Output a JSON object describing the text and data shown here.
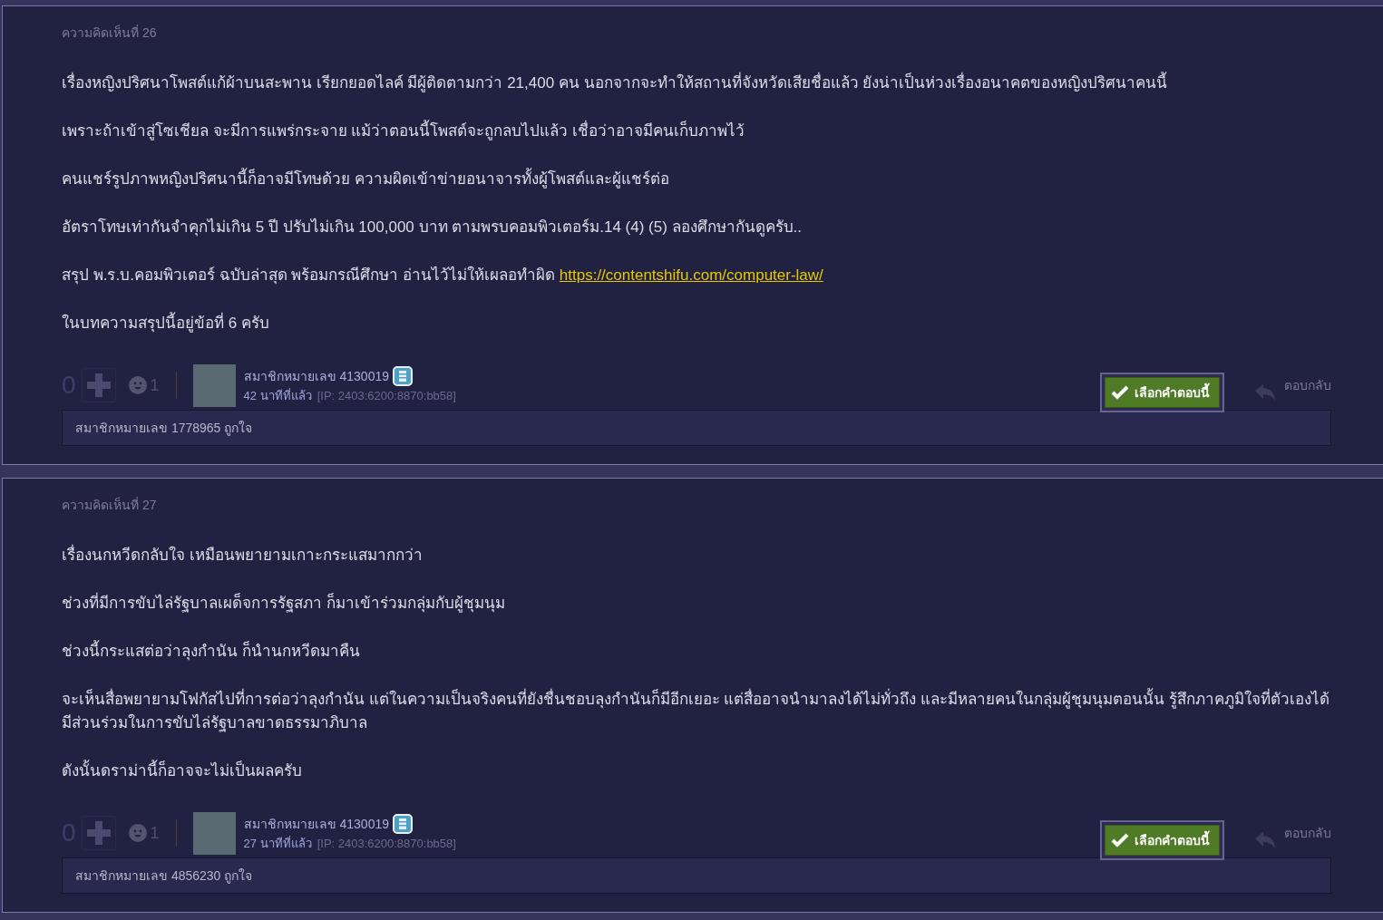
{
  "comments": [
    {
      "title": "ความคิดเห็นที่ 26",
      "paragraphs": [
        {
          "text": "เรื่องหญิงปริศนาโพสต์แก้ผ้าบนสะพาน เรียกยอดไลค์ มีผู้ติดตามกว่า 21,400 คน นอกจากจะทำให้สถานที่จังหวัดเสียชื่อแล้ว ยังน่าเป็นห่วงเรื่องอนาคตของหญิงปริศนาคนนี้"
        },
        {
          "text": "เพราะถ้าเข้าสู่โซเชียล จะมีการแพร่กระจาย แม้ว่าตอนนี้โพสต์จะถูกลบไปแล้ว เชื่อว่าอาจมีคนเก็บภาพไว้"
        },
        {
          "text": "คนแชร์รูปภาพหญิงปริศนานี้ก็อาจมีโทษด้วย ความผิดเข้าข่ายอนาจารทั้งผู้โพสต์และผู้แชร์ต่อ"
        },
        {
          "text": "อัตราโทษเท่ากันจำคุกไม่เกิน 5 ปี ปรับไม่เกิน 100,000 บาท ตามพรบคอมพิวเตอร์ม.14 (4) (5) ลองศึกษากันดูครับ.."
        },
        {
          "text": "สรุป พ.ร.บ.คอมพิวเตอร์ ฉบับล่าสุด พร้อมกรณีศึกษา อ่านไว้ไม่ให้เผลอทำผิด ",
          "link": "https://contentshifu.com/computer-law/"
        },
        {
          "text": "ในบทความสรุปนี้อยู่ข้อที่ 6 ครับ"
        }
      ],
      "score": "0",
      "emoji_count": "1",
      "member": "สมาชิกหมายเลข 4130019",
      "time": "42 นาทีที่แล้ว",
      "ip": "[IP: 2403:6200:8870:bb58]",
      "select_button": "เลือกคำตอบนี้",
      "reply": "ตอบกลับ",
      "likes": "สมาชิกหมายเลข 1778965 ถูกใจ"
    },
    {
      "title": "ความคิดเห็นที่ 27",
      "paragraphs": [
        {
          "text": "เรื่องนกหวีดกลับใจ เหมือนพยายามเกาะกระแสมากกว่า"
        },
        {
          "text": "ช่วงที่มีการขับไล่รัฐบาลเผด็จการรัฐสภา ก็มาเข้าร่วมกลุ่มกับผู้ชุมนุม"
        },
        {
          "text": "ช่วงนี้กระแสต่อว่าลุงกำนัน ก็นำนกหวีดมาคืน"
        },
        {
          "text": "จะเห็นสื่อพยายามโฟกัสไปที่การต่อว่าลุงกำนัน แต่ในความเป็นจริงคนที่ยังชื่นชอบลุงกำนันก็มีอีกเยอะ แต่สื่ออาจนำมาลงได้ไม่ทั่วถึง และมีหลายคนในกลุ่มผู้ชุมนุมตอนนั้น รู้สึกภาคภูมิใจที่ตัวเองได้มีส่วนร่วมในการขับไล่รัฐบาลขาดธรรมาภิบาล"
        },
        {
          "text": "ดังนั้นดราม่านี้ก็อาจจะไม่เป็นผลครับ"
        }
      ],
      "score": "0",
      "emoji_count": "1",
      "member": "สมาชิกหมายเลข 4130019",
      "time": "27 นาทีที่แล้ว",
      "ip": "[IP: 2403:6200:8870:bb58]",
      "select_button": "เลือกคำตอบนี้",
      "reply": "ตอบกลับ",
      "likes": "สมาชิกหมายเลข 4856230 ถูกใจ"
    }
  ]
}
